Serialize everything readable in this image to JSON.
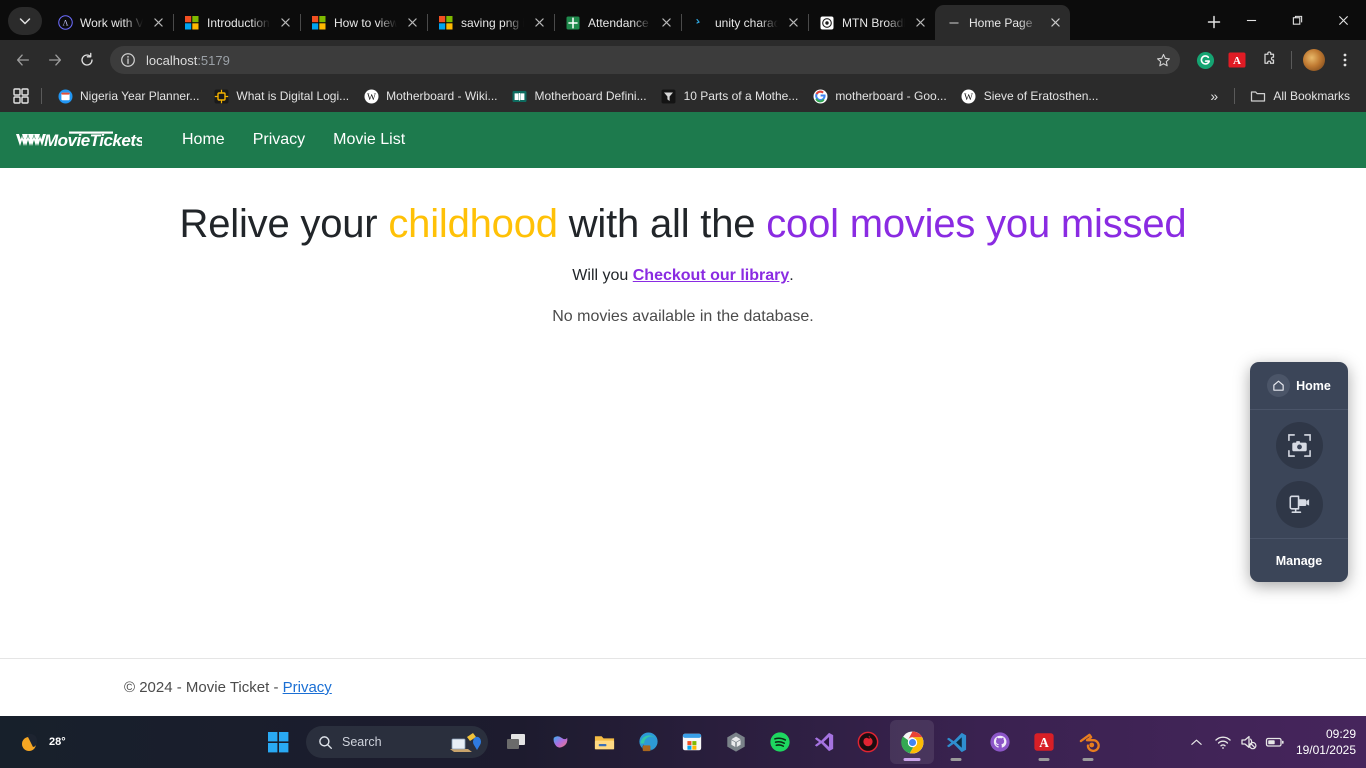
{
  "browser": {
    "tabs": [
      {
        "title": "Work with Va",
        "favicon": "vscode-lambda-icon",
        "active": false
      },
      {
        "title": "Introduction",
        "favicon": "microsoft-icon",
        "active": false
      },
      {
        "title": "How to view",
        "favicon": "microsoft-icon",
        "active": false
      },
      {
        "title": "saving png i",
        "favicon": "microsoft-icon",
        "active": false
      },
      {
        "title": "Attendance",
        "favicon": "excel-icon",
        "active": false
      },
      {
        "title": "unity charac",
        "favicon": "unity-blue-icon",
        "active": false
      },
      {
        "title": "MTN Broadb",
        "favicon": "mtn-icon",
        "active": false
      },
      {
        "title": "Home Page",
        "favicon": "blank-page-icon",
        "active": true
      }
    ],
    "new_tab_label": "+",
    "window_controls": [
      "minimize",
      "restore",
      "close"
    ],
    "toolbar": {
      "back_label": "Back",
      "forward_label": "Forward",
      "reload_label": "Reload",
      "url_host": "localhost",
      "url_port": ":5179",
      "bookmark_label": "Bookmark this tab",
      "extensions": [
        "grammarly-icon",
        "adobe-acrobat-icon",
        "puzzle-extensions-icon"
      ],
      "profile_label": "Profile",
      "menu_label": "Customize and control Google Chrome"
    },
    "bookmarks": {
      "apps_label": "Apps",
      "items": [
        {
          "label": "Nigeria Year Planner...",
          "favicon": "calendar-icon"
        },
        {
          "label": "What is Digital Logi...",
          "favicon": "chip-icon"
        },
        {
          "label": "Motherboard - Wiki...",
          "favicon": "wikipedia-icon"
        },
        {
          "label": "Motherboard Defini...",
          "favicon": "book-icon"
        },
        {
          "label": "10 Parts of a Mothe...",
          "favicon": "dark-t-icon"
        },
        {
          "label": "motherboard - Goo...",
          "favicon": "google-icon"
        },
        {
          "label": "Sieve of Eratosthen...",
          "favicon": "wikipedia-icon"
        }
      ],
      "overflow_label": "»",
      "all_bookmarks_label": "All Bookmarks"
    }
  },
  "site": {
    "brand_name": "MovieTickets",
    "nav": [
      {
        "label": "Home"
      },
      {
        "label": "Privacy"
      },
      {
        "label": "Movie List"
      }
    ],
    "hero": {
      "line_part1": "Relive your ",
      "line_highlight1": "childhood",
      "line_part2": " with all the ",
      "line_highlight2": "cool movies you missed",
      "sub_prefix": "Will you ",
      "sub_link": "Checkout our library",
      "sub_suffix": ".",
      "empty_message": "No movies available in the database."
    },
    "footer": {
      "text": "© 2024 - Movie Ticket - ",
      "link": "Privacy"
    },
    "colors": {
      "nav_green": "#1d7a4d",
      "amber": "#ffc107",
      "purple": "#8a2be2",
      "footer_link": "#1a6fd4"
    }
  },
  "capture_widget": {
    "header_label": "Home",
    "header_icon": "home-icon",
    "buttons": [
      {
        "icon": "screenshot-capture-icon",
        "label": "Capture image"
      },
      {
        "icon": "screen-record-icon",
        "label": "Record video"
      }
    ],
    "footer_label": "Manage",
    "panel_color": "#3b4558"
  },
  "taskbar": {
    "weather": {
      "temp": "28°",
      "icon": "sun-cloud-icon"
    },
    "start_label": "Start",
    "search_placeholder": "Search",
    "search_icon": "search-icon",
    "apps": [
      {
        "icon": "task-view-icon",
        "label": "Task View",
        "active": false,
        "running": false
      },
      {
        "icon": "copilot-icon",
        "label": "Copilot",
        "active": false,
        "running": false
      },
      {
        "icon": "file-explorer-icon",
        "label": "File Explorer",
        "active": false,
        "running": false
      },
      {
        "icon": "edge-icon",
        "label": "Microsoft Edge",
        "active": false,
        "running": false
      },
      {
        "icon": "microsoft-store-icon",
        "label": "Microsoft Store",
        "active": false,
        "running": false
      },
      {
        "icon": "unity-icon",
        "label": "Unity Hub",
        "active": false,
        "running": false
      },
      {
        "icon": "spotify-icon",
        "label": "Spotify",
        "active": false,
        "running": false
      },
      {
        "icon": "visual-studio-icon",
        "label": "Visual Studio",
        "active": false,
        "running": false
      },
      {
        "icon": "red-circle-app-icon",
        "label": "App",
        "active": false,
        "running": false
      },
      {
        "icon": "chrome-icon",
        "label": "Google Chrome",
        "active": true,
        "running": true
      },
      {
        "icon": "vscode-icon",
        "label": "Visual Studio Code",
        "active": false,
        "running": true
      },
      {
        "icon": "github-icon",
        "label": "GitHub Desktop",
        "active": false,
        "running": false
      },
      {
        "icon": "adobe-acrobat-icon",
        "label": "Adobe Acrobat",
        "active": false,
        "running": true
      },
      {
        "icon": "blender-icon",
        "label": "Blender",
        "active": false,
        "running": true
      }
    ],
    "tray": {
      "overflow_icon": "chevron-up-icon",
      "wifi_icon": "wifi-icon",
      "volume_icon": "speaker-muted-icon",
      "battery_icon": "battery-icon",
      "time": "09:29",
      "date": "19/01/2025"
    }
  }
}
